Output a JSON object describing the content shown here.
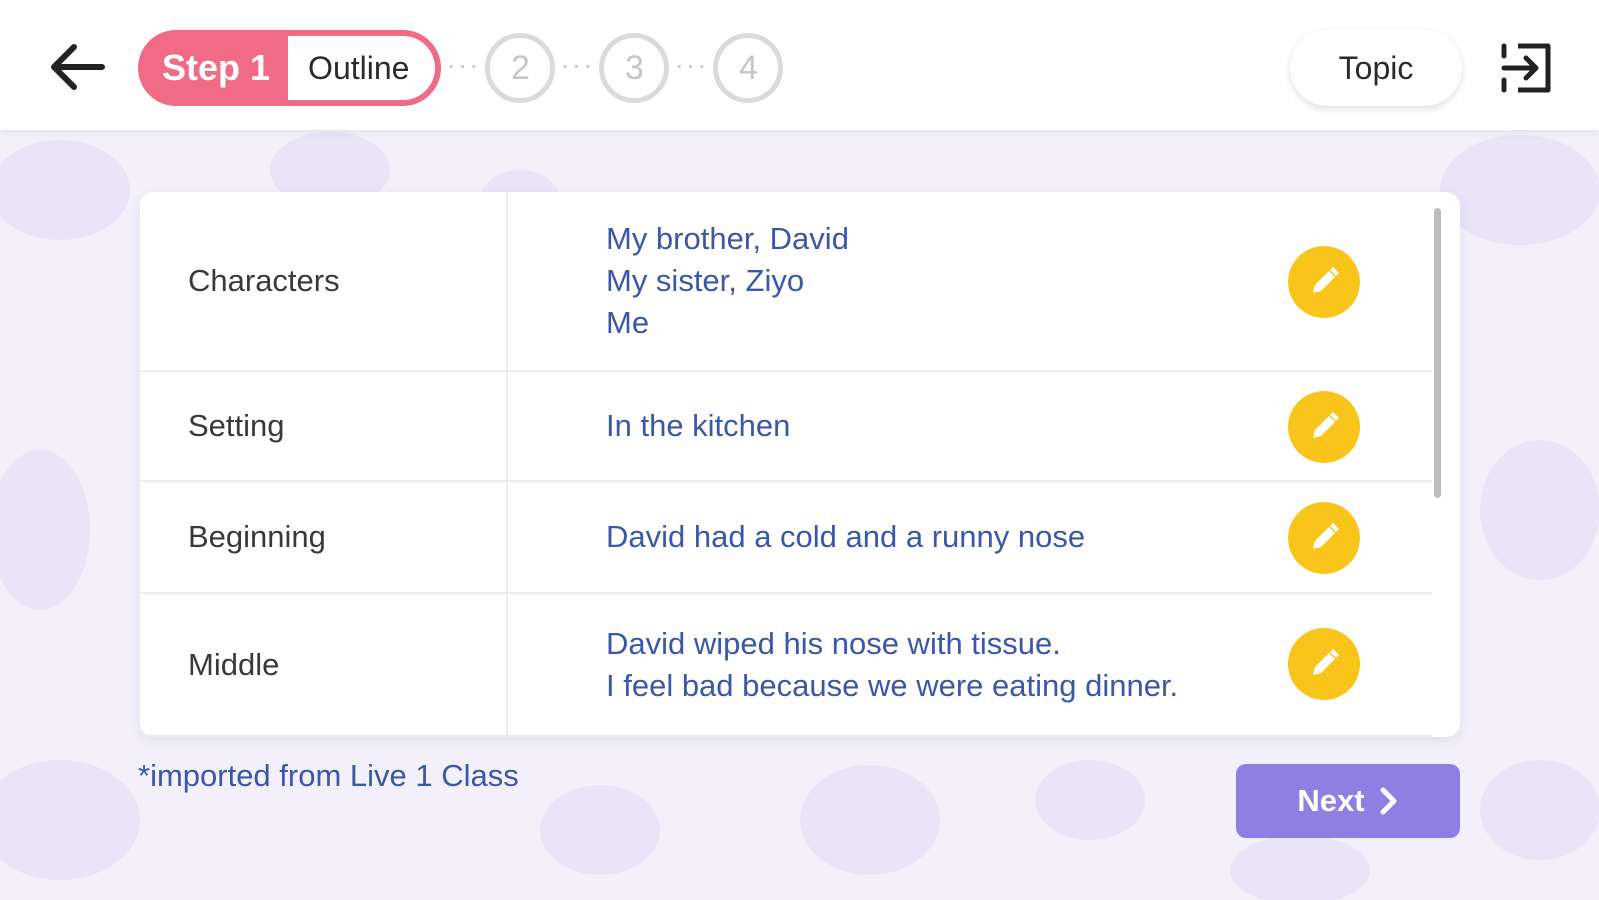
{
  "header": {
    "back_icon": "arrow-left-icon",
    "steps": {
      "active_label": "Step 1",
      "active_name": "Outline",
      "separator": "···",
      "step2": "2",
      "step3": "3",
      "step4": "4"
    },
    "topic_label": "Topic",
    "exit_icon": "exit-icon"
  },
  "outline": {
    "rows": [
      {
        "label": "Characters",
        "lines": [
          "My brother, David",
          "My sister, Ziyo",
          "Me"
        ]
      },
      {
        "label": "Setting",
        "lines": [
          "In the kitchen"
        ]
      },
      {
        "label": "Beginning",
        "lines": [
          "David had a cold and a runny nose"
        ]
      },
      {
        "label": "Middle",
        "lines": [
          "David wiped his nose with tissue.",
          "I feel bad because we were eating dinner."
        ]
      }
    ],
    "edit_icon": "pencil-icon"
  },
  "footnote": "*imported from Live 1 Class",
  "next_label": "Next",
  "colors": {
    "accent_pink": "#f16a86",
    "accent_purple": "#8f7fe3",
    "edit_yellow": "#f9c51b",
    "value_blue": "#3b57a8",
    "background": "#f3f0fb"
  }
}
